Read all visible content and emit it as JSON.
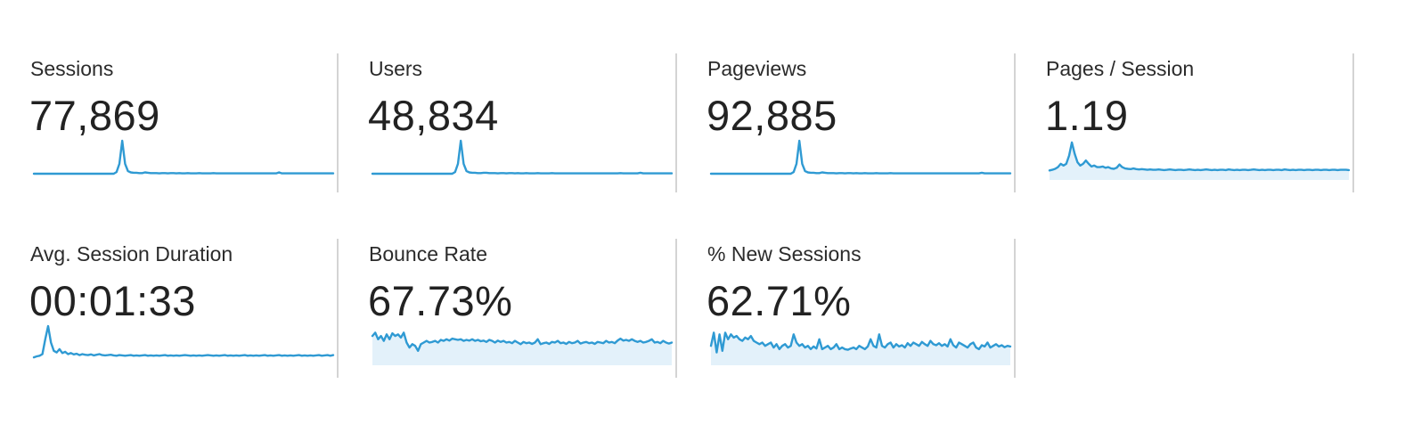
{
  "metrics": [
    {
      "label": "Sessions",
      "value": "77,869",
      "sparkline": [
        0,
        0,
        0,
        0,
        0,
        0,
        0,
        0,
        0,
        0,
        0,
        0,
        0,
        0,
        0,
        0,
        0,
        0,
        0,
        0,
        0,
        0,
        0,
        0,
        0,
        0,
        0,
        0,
        0,
        0.05,
        0.3,
        1,
        0.3,
        0.08,
        0.04,
        0.03,
        0.03,
        0.02,
        0.02,
        0.04,
        0.03,
        0.02,
        0.02,
        0.02,
        0.01,
        0.02,
        0.02,
        0.01,
        0.02,
        0.02,
        0.01,
        0.02,
        0.01,
        0.01,
        0.02,
        0.01,
        0.01,
        0.01,
        0.02,
        0.01,
        0.01,
        0.01,
        0.01,
        0.02,
        0.01,
        0.01,
        0.01,
        0.01,
        0.01,
        0.01,
        0.01,
        0.01,
        0.01,
        0.01,
        0.01,
        0.01,
        0.01,
        0.01,
        0.01,
        0.01,
        0.01,
        0.01,
        0.01,
        0.01,
        0.01,
        0.01,
        0.04,
        0.01,
        0.01,
        0.01,
        0.01,
        0.01,
        0.01,
        0.01,
        0.01,
        0.01,
        0.01,
        0.01,
        0.01,
        0.01,
        0.01,
        0.01,
        0.01,
        0.01,
        0.01,
        0.01
      ]
    },
    {
      "label": "Users",
      "value": "48,834",
      "sparkline": [
        0,
        0,
        0,
        0,
        0,
        0,
        0,
        0,
        0,
        0,
        0,
        0,
        0,
        0,
        0,
        0,
        0,
        0,
        0,
        0,
        0,
        0,
        0,
        0,
        0,
        0,
        0,
        0,
        0,
        0.05,
        0.3,
        1,
        0.3,
        0.08,
        0.04,
        0.03,
        0.03,
        0.02,
        0.02,
        0.03,
        0.03,
        0.02,
        0.02,
        0.02,
        0.01,
        0.02,
        0.02,
        0.01,
        0.02,
        0.02,
        0.01,
        0.02,
        0.01,
        0.01,
        0.02,
        0.01,
        0.01,
        0.01,
        0.02,
        0.01,
        0.01,
        0.01,
        0.01,
        0.02,
        0.01,
        0.01,
        0.01,
        0.01,
        0.01,
        0.01,
        0.01,
        0.01,
        0.01,
        0.01,
        0.01,
        0.01,
        0.01,
        0.01,
        0.01,
        0.01,
        0.01,
        0.01,
        0.01,
        0.01,
        0.01,
        0.01,
        0.01,
        0.02,
        0.01,
        0.01,
        0.01,
        0.01,
        0.01,
        0.01,
        0.03,
        0.01,
        0.01,
        0.01,
        0.01,
        0.01,
        0.01,
        0.01,
        0.01,
        0.01,
        0.01,
        0.01
      ]
    },
    {
      "label": "Pageviews",
      "value": "92,885",
      "sparkline": [
        0,
        0,
        0,
        0,
        0,
        0,
        0,
        0,
        0,
        0,
        0,
        0,
        0,
        0,
        0,
        0,
        0,
        0,
        0,
        0,
        0,
        0,
        0,
        0,
        0,
        0,
        0,
        0,
        0,
        0.05,
        0.3,
        1,
        0.3,
        0.08,
        0.04,
        0.03,
        0.03,
        0.02,
        0.02,
        0.04,
        0.03,
        0.02,
        0.02,
        0.02,
        0.01,
        0.02,
        0.02,
        0.01,
        0.02,
        0.02,
        0.01,
        0.02,
        0.01,
        0.01,
        0.02,
        0.01,
        0.01,
        0.01,
        0.02,
        0.01,
        0.01,
        0.01,
        0.01,
        0.02,
        0.01,
        0.01,
        0.01,
        0.01,
        0.01,
        0.01,
        0.01,
        0.01,
        0.01,
        0.01,
        0.01,
        0.01,
        0.01,
        0.01,
        0.01,
        0.01,
        0.01,
        0.01,
        0.01,
        0.01,
        0.01,
        0.01,
        0.01,
        0.01,
        0.01,
        0.01,
        0.01,
        0.01,
        0.01,
        0.01,
        0.01,
        0.03,
        0.01,
        0.01,
        0.01,
        0.01,
        0.01,
        0.01,
        0.01,
        0.01,
        0.01,
        0.01
      ]
    },
    {
      "label": "Pages / Session",
      "value": "1.19",
      "sparkline": [
        0.1,
        0.12,
        0.15,
        0.2,
        0.3,
        0.25,
        0.3,
        0.55,
        0.95,
        0.6,
        0.35,
        0.25,
        0.3,
        0.4,
        0.3,
        0.22,
        0.25,
        0.2,
        0.2,
        0.22,
        0.18,
        0.2,
        0.16,
        0.15,
        0.18,
        0.28,
        0.2,
        0.16,
        0.15,
        0.14,
        0.16,
        0.14,
        0.13,
        0.14,
        0.13,
        0.12,
        0.13,
        0.12,
        0.12,
        0.13,
        0.12,
        0.11,
        0.12,
        0.13,
        0.12,
        0.11,
        0.12,
        0.12,
        0.11,
        0.12,
        0.13,
        0.12,
        0.11,
        0.12,
        0.11,
        0.12,
        0.13,
        0.12,
        0.11,
        0.12,
        0.11,
        0.12,
        0.12,
        0.11,
        0.13,
        0.12,
        0.11,
        0.12,
        0.11,
        0.12,
        0.12,
        0.11,
        0.12,
        0.13,
        0.12,
        0.11,
        0.12,
        0.11,
        0.12,
        0.12,
        0.11,
        0.12,
        0.12,
        0.11,
        0.13,
        0.12,
        0.11,
        0.12,
        0.11,
        0.12,
        0.12,
        0.11,
        0.12,
        0.12,
        0.11,
        0.12,
        0.12,
        0.11,
        0.12,
        0.12,
        0.11,
        0.12,
        0.12,
        0.11,
        0.12,
        0.12,
        0.12,
        0.11
      ]
    },
    {
      "label": "Avg. Session Duration",
      "value": "00:01:33",
      "sparkline": [
        0.05,
        0.08,
        0.1,
        0.15,
        0.6,
        1,
        0.5,
        0.25,
        0.2,
        0.3,
        0.18,
        0.22,
        0.15,
        0.18,
        0.14,
        0.16,
        0.12,
        0.15,
        0.13,
        0.12,
        0.14,
        0.11,
        0.13,
        0.15,
        0.12,
        0.11,
        0.12,
        0.13,
        0.11,
        0.1,
        0.12,
        0.11,
        0.1,
        0.11,
        0.12,
        0.1,
        0.11,
        0.1,
        0.11,
        0.12,
        0.1,
        0.11,
        0.1,
        0.11,
        0.1,
        0.11,
        0.12,
        0.1,
        0.11,
        0.1,
        0.11,
        0.1,
        0.11,
        0.12,
        0.11,
        0.1,
        0.11,
        0.1,
        0.11,
        0.1,
        0.11,
        0.12,
        0.11,
        0.1,
        0.11,
        0.1,
        0.11,
        0.12,
        0.1,
        0.11,
        0.1,
        0.11,
        0.1,
        0.11,
        0.12,
        0.1,
        0.11,
        0.1,
        0.11,
        0.1,
        0.11,
        0.12,
        0.1,
        0.11,
        0.1,
        0.11,
        0.12,
        0.1,
        0.11,
        0.1,
        0.11,
        0.1,
        0.11,
        0.12,
        0.1,
        0.11,
        0.1,
        0.11,
        0.1,
        0.11,
        0.12,
        0.1,
        0.11,
        0.12,
        0.1,
        0.12
      ]
    },
    {
      "label": "Bounce Rate",
      "value": "67.73%",
      "sparkline": [
        0.7,
        0.8,
        0.6,
        0.7,
        0.55,
        0.75,
        0.6,
        0.78,
        0.7,
        0.75,
        0.65,
        0.8,
        0.5,
        0.35,
        0.45,
        0.4,
        0.25,
        0.45,
        0.5,
        0.55,
        0.5,
        0.52,
        0.55,
        0.5,
        0.58,
        0.55,
        0.6,
        0.56,
        0.62,
        0.6,
        0.58,
        0.6,
        0.55,
        0.58,
        0.56,
        0.6,
        0.55,
        0.58,
        0.54,
        0.56,
        0.52,
        0.58,
        0.55,
        0.5,
        0.56,
        0.52,
        0.55,
        0.5,
        0.52,
        0.48,
        0.55,
        0.5,
        0.45,
        0.52,
        0.48,
        0.5,
        0.46,
        0.5,
        0.6,
        0.45,
        0.48,
        0.5,
        0.46,
        0.52,
        0.5,
        0.55,
        0.48,
        0.5,
        0.46,
        0.52,
        0.48,
        0.5,
        0.55,
        0.47,
        0.5,
        0.52,
        0.48,
        0.5,
        0.46,
        0.52,
        0.5,
        0.48,
        0.55,
        0.5,
        0.52,
        0.48,
        0.56,
        0.62,
        0.56,
        0.58,
        0.55,
        0.6,
        0.55,
        0.52,
        0.55,
        0.5,
        0.52,
        0.55,
        0.6,
        0.5,
        0.52,
        0.48,
        0.55,
        0.5,
        0.47,
        0.5
      ]
    },
    {
      "label": "% New Sessions",
      "value": "62.71%",
      "sparkline": [
        0.4,
        0.8,
        0.2,
        0.75,
        0.25,
        0.8,
        0.6,
        0.75,
        0.65,
        0.7,
        0.6,
        0.55,
        0.65,
        0.6,
        0.7,
        0.55,
        0.5,
        0.45,
        0.5,
        0.4,
        0.45,
        0.5,
        0.35,
        0.45,
        0.3,
        0.4,
        0.45,
        0.35,
        0.4,
        0.75,
        0.5,
        0.4,
        0.45,
        0.35,
        0.4,
        0.3,
        0.38,
        0.32,
        0.6,
        0.3,
        0.35,
        0.4,
        0.3,
        0.35,
        0.45,
        0.3,
        0.35,
        0.3,
        0.28,
        0.32,
        0.35,
        0.3,
        0.4,
        0.35,
        0.3,
        0.38,
        0.6,
        0.4,
        0.35,
        0.75,
        0.4,
        0.35,
        0.45,
        0.5,
        0.35,
        0.45,
        0.38,
        0.42,
        0.35,
        0.48,
        0.4,
        0.5,
        0.45,
        0.4,
        0.52,
        0.45,
        0.4,
        0.55,
        0.45,
        0.42,
        0.48,
        0.4,
        0.45,
        0.38,
        0.6,
        0.42,
        0.35,
        0.5,
        0.45,
        0.4,
        0.35,
        0.45,
        0.5,
        0.35,
        0.3,
        0.42,
        0.38,
        0.5,
        0.35,
        0.4,
        0.45,
        0.38,
        0.42,
        0.36,
        0.4,
        0.38
      ]
    }
  ],
  "colors": {
    "sparkline_stroke": "#2f9ad3",
    "sparkline_fill": "#e3f1fa",
    "divider": "#d4d4d4"
  }
}
